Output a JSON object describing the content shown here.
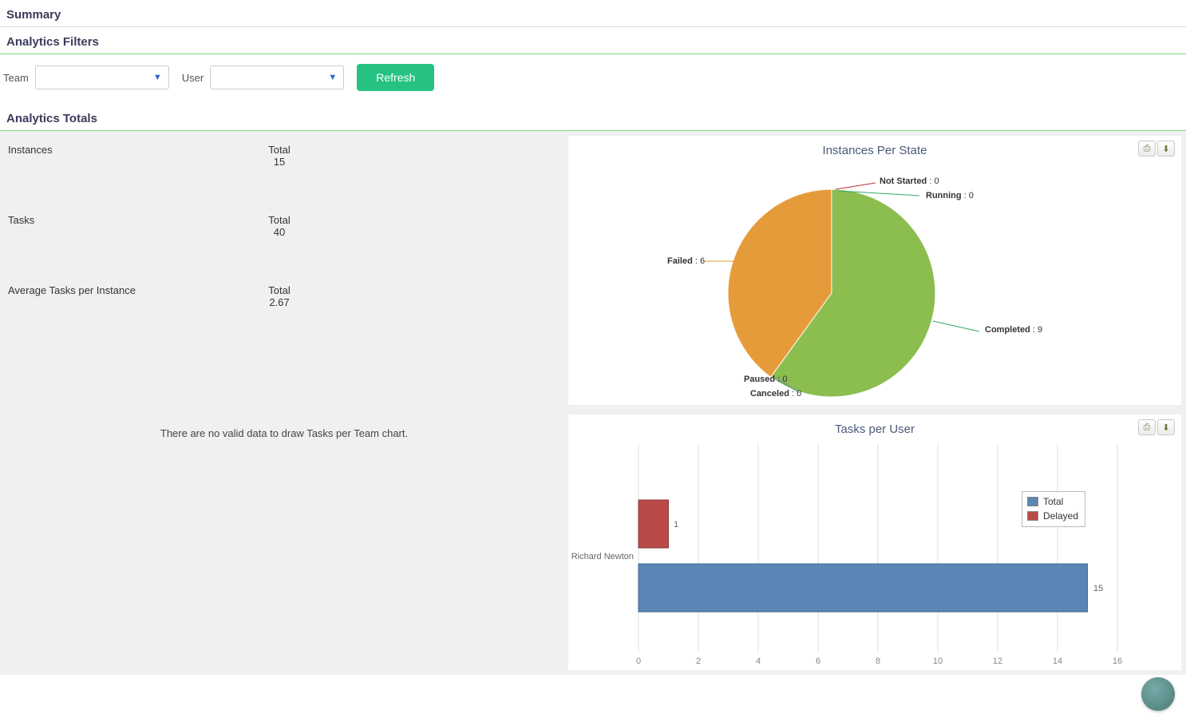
{
  "headers": {
    "summary": "Summary",
    "filters": "Analytics Filters",
    "totals": "Analytics Totals"
  },
  "filters": {
    "team_label": "Team",
    "user_label": "User",
    "team_value": "",
    "user_value": "",
    "refresh": "Refresh"
  },
  "kpis": {
    "instances": {
      "label": "Instances",
      "total_label": "Total",
      "value": "15"
    },
    "tasks": {
      "label": "Tasks",
      "total_label": "Total",
      "value": "40"
    },
    "avg": {
      "label": "Average Tasks per Instance",
      "total_label": "Total",
      "value": "2.67"
    }
  },
  "messages": {
    "no_team_data": "There are no valid data to draw Tasks per Team chart."
  },
  "pie": {
    "title": "Instances Per State",
    "labels": {
      "not_started": "Not Started",
      "running": "Running",
      "completed": "Completed",
      "canceled": "Canceled",
      "paused": "Paused",
      "failed": "Failed"
    },
    "values": {
      "not_started": "0",
      "running": "0",
      "completed": "9",
      "canceled": "0",
      "paused": "0",
      "failed": "6"
    }
  },
  "bar": {
    "title": "Tasks per User",
    "legend": {
      "total": "Total",
      "delayed": "Delayed"
    },
    "user": "Richard Newton",
    "delayed_value": "1",
    "total_value": "15"
  },
  "colors": {
    "green": "#8bbd4f",
    "orange": "#e69b3a",
    "blue": "#5a85b5",
    "red": "#b94a48"
  },
  "chart_data": [
    {
      "type": "pie",
      "title": "Instances Per State",
      "series": [
        {
          "name": "Not Started",
          "value": 0
        },
        {
          "name": "Running",
          "value": 0
        },
        {
          "name": "Completed",
          "value": 9
        },
        {
          "name": "Canceled",
          "value": 0
        },
        {
          "name": "Paused",
          "value": 0
        },
        {
          "name": "Failed",
          "value": 6
        }
      ]
    },
    {
      "type": "bar",
      "orientation": "horizontal",
      "title": "Tasks per User",
      "categories": [
        "Richard Newton"
      ],
      "series": [
        {
          "name": "Total",
          "values": [
            15
          ]
        },
        {
          "name": "Delayed",
          "values": [
            1
          ]
        }
      ],
      "xlabel": "",
      "ylabel": "",
      "xlim": [
        0,
        16
      ],
      "xticks": [
        0,
        2,
        4,
        6,
        8,
        10,
        12,
        14,
        16
      ],
      "legend_position": "right"
    }
  ]
}
